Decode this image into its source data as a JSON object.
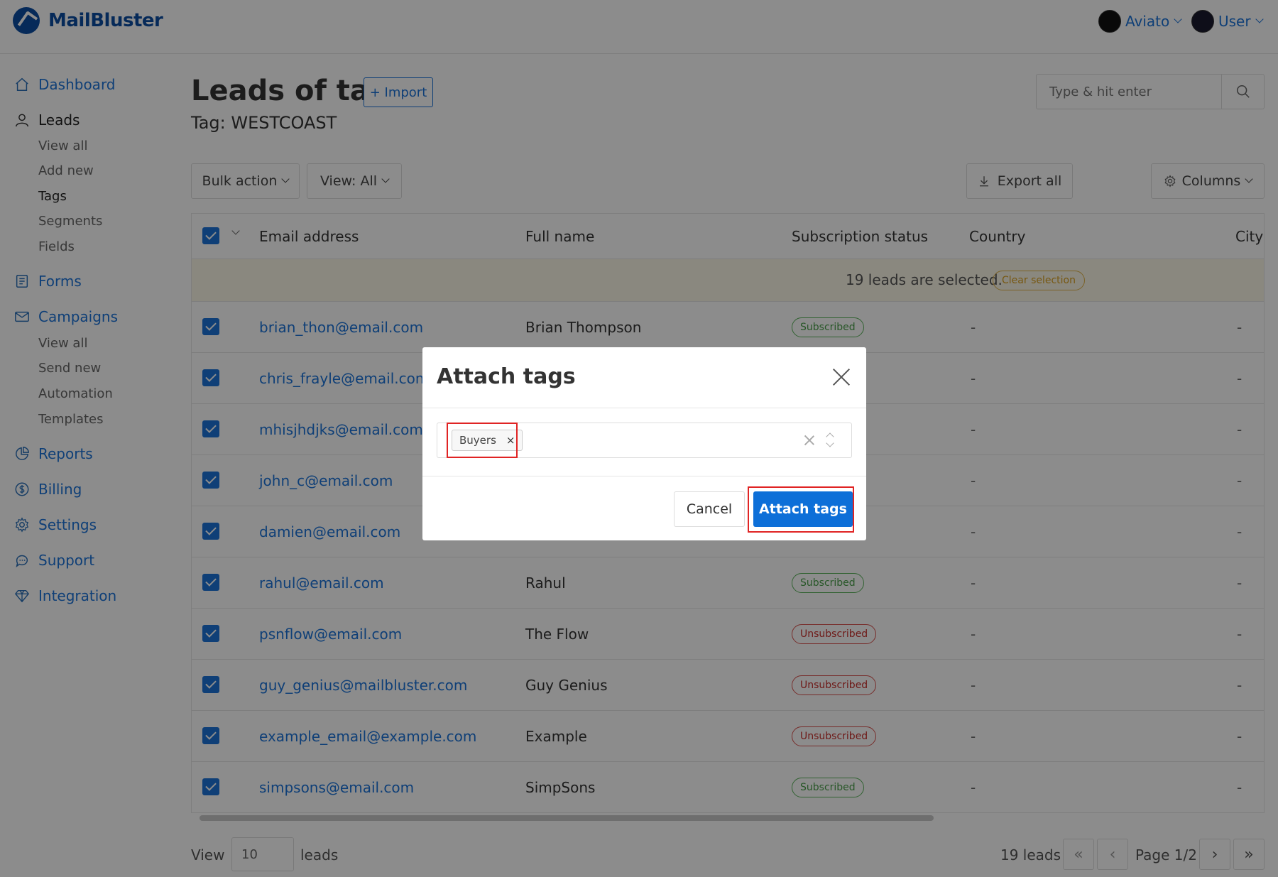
{
  "brand": {
    "name": "MailBluster"
  },
  "header": {
    "org_name": "Aviato",
    "user_name": "User"
  },
  "sidebar": {
    "items": [
      {
        "label": "Dashboard"
      },
      {
        "label": "Leads",
        "sub": [
          "View all",
          "Add new",
          "Tags",
          "Segments",
          "Fields"
        ]
      },
      {
        "label": "Forms"
      },
      {
        "label": "Campaigns",
        "sub": [
          "View all",
          "Send new",
          "Automation",
          "Templates"
        ]
      },
      {
        "label": "Reports"
      },
      {
        "label": "Billing"
      },
      {
        "label": "Settings"
      },
      {
        "label": "Support"
      },
      {
        "label": "Integration"
      }
    ]
  },
  "page": {
    "title": "Leads of tag",
    "import_label": "+ Import",
    "tag_line": "Tag: WESTCOAST",
    "search_placeholder": "Type & hit enter"
  },
  "toolbar": {
    "bulk_action": "Bulk action",
    "view_filter": "View: All",
    "export_all": "Export all",
    "columns": "Columns"
  },
  "table": {
    "columns": [
      "Email address",
      "Full name",
      "Subscription status",
      "Country",
      "City"
    ],
    "selection_text": "19 leads are selected.",
    "clear_selection": "Clear selection",
    "rows": [
      {
        "email": "brian_thon@email.com",
        "name": "Brian Thompson",
        "status": "Subscribed",
        "country": "-",
        "city": "-"
      },
      {
        "email": "chris_frayle@email.com",
        "name": "",
        "status": "",
        "country": "-",
        "city": "-"
      },
      {
        "email": "mhisjhdjks@email.com",
        "name": "",
        "status": "",
        "country": "-",
        "city": "-"
      },
      {
        "email": "john_c@email.com",
        "name": "",
        "status": "",
        "country": "-",
        "city": "-"
      },
      {
        "email": "damien@email.com",
        "name": "",
        "status": "",
        "country": "-",
        "city": "-"
      },
      {
        "email": "rahul@email.com",
        "name": "Rahul",
        "status": "Subscribed",
        "country": "-",
        "city": "-"
      },
      {
        "email": "psnflow@email.com",
        "name": "The Flow",
        "status": "Unsubscribed",
        "country": "-",
        "city": "-"
      },
      {
        "email": "guy_genius@mailbluster.com",
        "name": "Guy Genius",
        "status": "Unsubscribed",
        "country": "-",
        "city": "-"
      },
      {
        "email": "example_email@example.com",
        "name": "Example",
        "status": "Unsubscribed",
        "country": "-",
        "city": "-"
      },
      {
        "email": "simpsons@email.com",
        "name": "SimpSons",
        "status": "Subscribed",
        "country": "-",
        "city": "-"
      }
    ]
  },
  "footer": {
    "view_label": "View",
    "per_page": "10",
    "leads_label": "leads",
    "total": "19 leads",
    "page_info": "Page 1/2"
  },
  "modal": {
    "title": "Attach tags",
    "selected_tag": "Buyers",
    "tag_remove": "×",
    "cancel": "Cancel",
    "confirm": "Attach tags"
  },
  "colors": {
    "primary": "#1c74d9",
    "brand": "#0c4da2",
    "confirm_button": "#0d6fd8",
    "highlight": "#e02424",
    "subscribed": "#4a9e4a",
    "unsubscribed": "#c9302c"
  }
}
